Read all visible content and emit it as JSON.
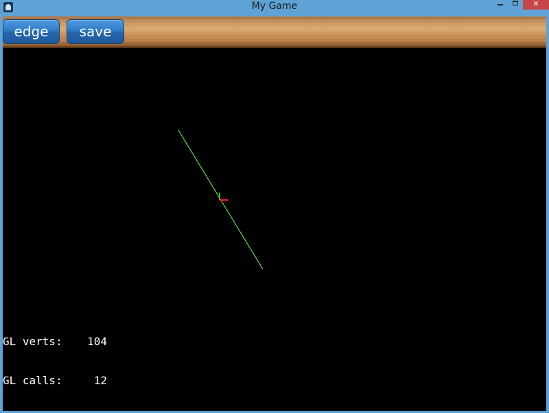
{
  "window": {
    "title": "My Game",
    "app_icon": "game-app-icon",
    "controls": {
      "minimize": "minimize-icon",
      "maximize": "maximize-icon",
      "close": "close-icon",
      "close_glyph": "✕"
    }
  },
  "toolbar": {
    "edge_label": "edge",
    "save_label": "save"
  },
  "scene": {
    "background": "#000000",
    "line_color": "#7cff4a",
    "axis_x_color": "#ff2020",
    "axis_y_color": "#22ff22"
  },
  "stats": [
    {
      "label": "GL verts:",
      "value": "104"
    },
    {
      "label": "GL calls:",
      "value": "12"
    }
  ]
}
